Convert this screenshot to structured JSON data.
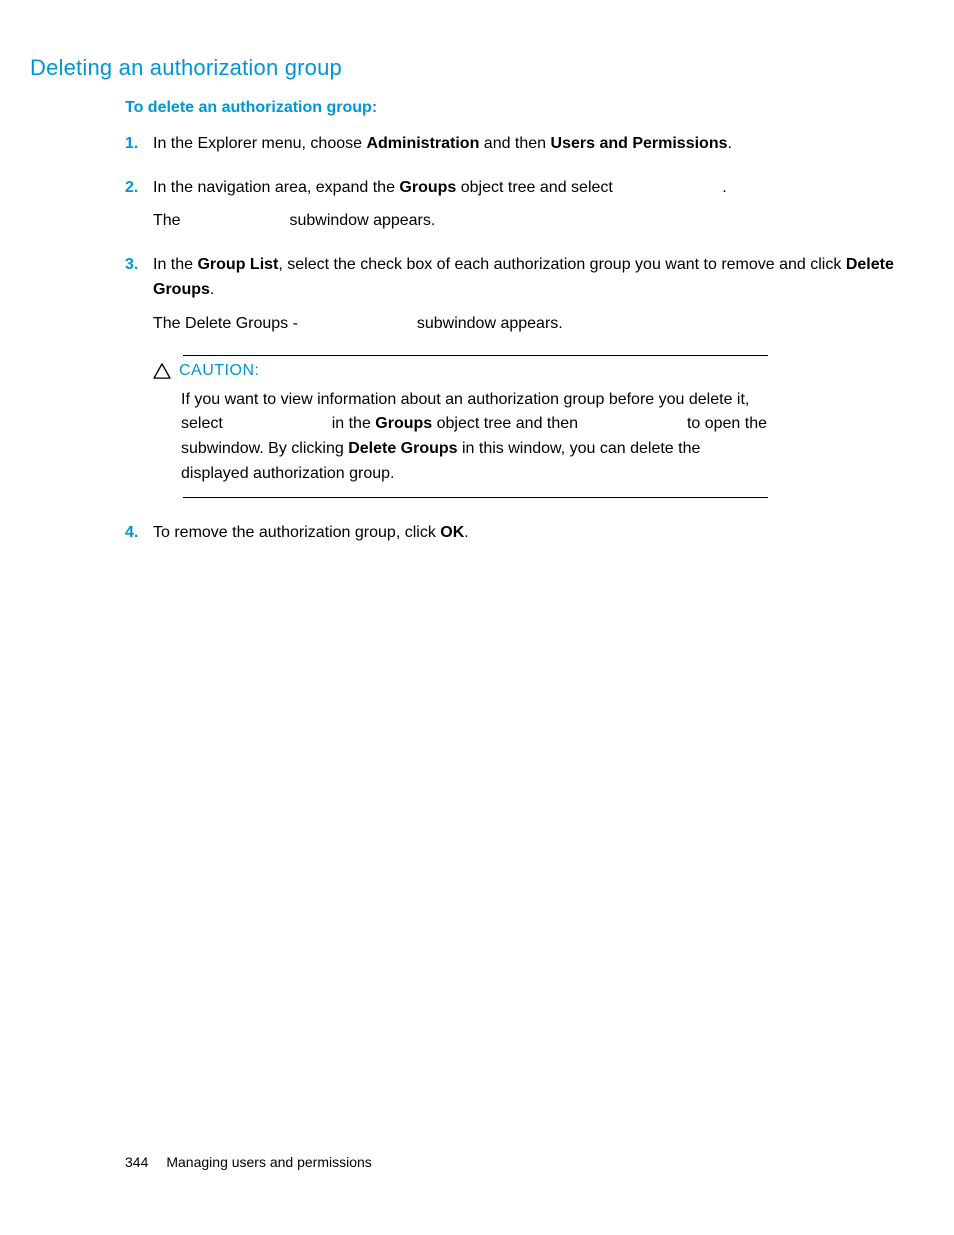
{
  "heading": "Deleting an authorization group",
  "subheading": "To delete an authorization group:",
  "steps": {
    "s1": {
      "num": "1.",
      "t1": "In the Explorer menu, choose ",
      "t2": "Administration",
      "t3": " and then ",
      "t4": "Users and Permissions",
      "t5": "."
    },
    "s2": {
      "num": "2.",
      "t1": "In the navigation area, expand the ",
      "t2": "Groups",
      "t3": " object tree and select ",
      "t4": ".",
      "l2a": "The ",
      "l2b": " subwindow appears."
    },
    "s3": {
      "num": "3.",
      "t1": "In the ",
      "t2": "Group List",
      "t3": ", select the check box of each authorization group you want to remove and click ",
      "t4": "Delete Groups",
      "t5": ".",
      "l2a": "The Delete Groups - ",
      "l2b": " subwindow appears."
    },
    "s4": {
      "num": "4.",
      "t1": "To remove the authorization group, click ",
      "t2": "OK",
      "t3": "."
    }
  },
  "caution": {
    "label": "CAUTION:",
    "p1a": "If you want to view information about an authorization group before you delete it, select ",
    "p1b": " in the ",
    "p1c": "Groups",
    "p1d": " object tree and then ",
    "p1e": " to open the ",
    "p2a": "subwindow. By clicking ",
    "p2b": "Delete Groups",
    "p2c": " in this window, you can delete the displayed authorization group."
  },
  "footer": {
    "page": "344",
    "title": "Managing users and permissions"
  }
}
